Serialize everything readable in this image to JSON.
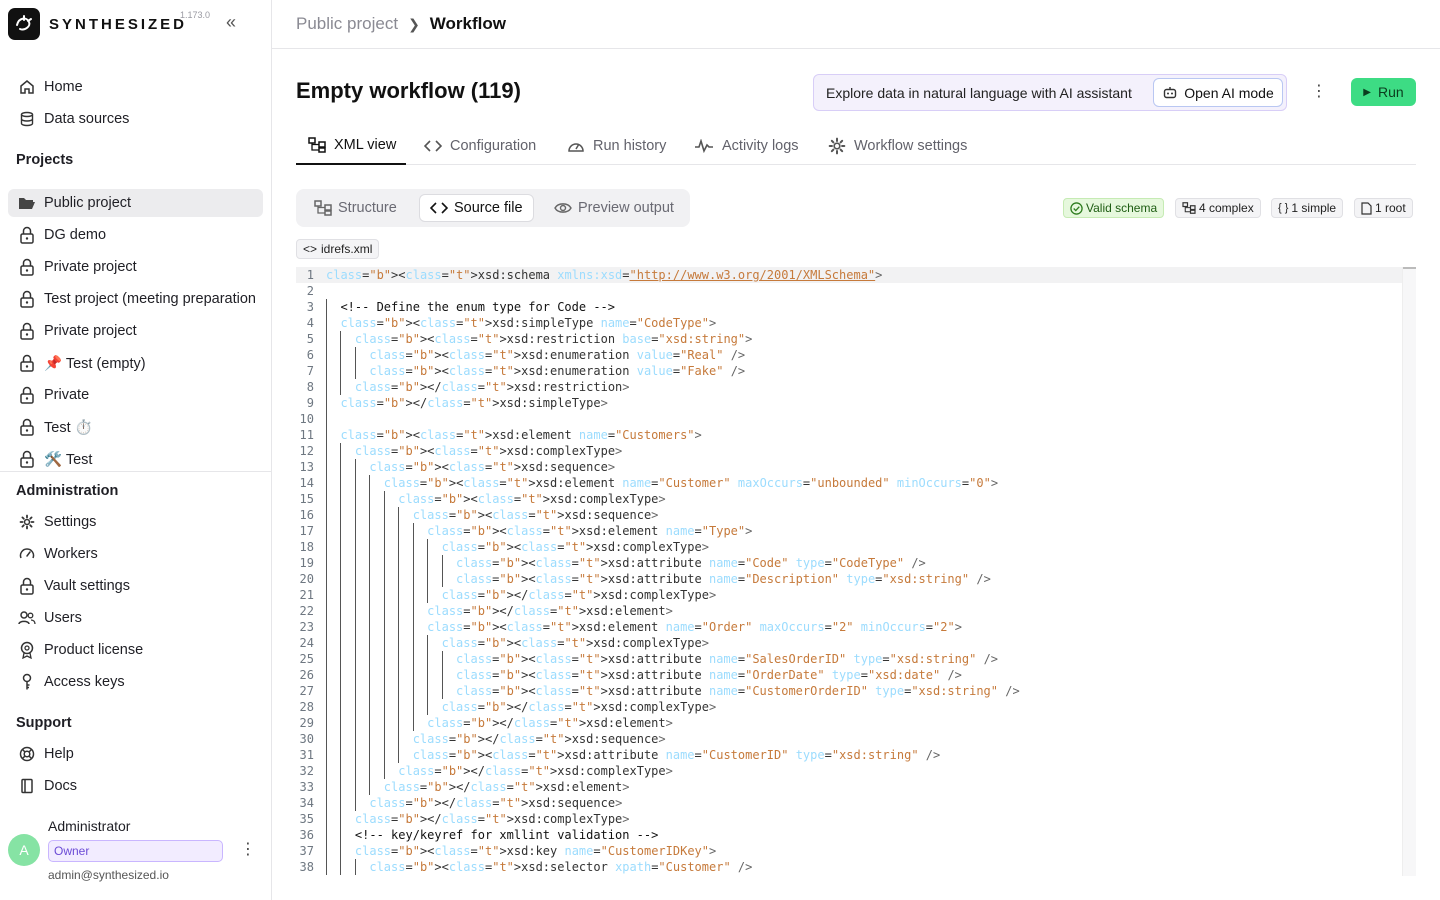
{
  "app": {
    "brand": "SYNTHESIZED",
    "version": "1.173.0",
    "collapse_icon": "«"
  },
  "nav": {
    "home": "Home",
    "data_sources": "Data sources",
    "projects_title": "Projects",
    "projects": [
      {
        "label": "Public project",
        "icon": "folder-open-icon"
      },
      {
        "label": "DG demo",
        "icon": "lock-icon"
      },
      {
        "label": "Private project",
        "icon": "lock-icon"
      },
      {
        "label": "Test project (meeting preparation",
        "icon": "lock-icon"
      },
      {
        "label": "Private project",
        "icon": "lock-icon"
      },
      {
        "label": "📌 Test (empty)",
        "icon": "lock-icon"
      },
      {
        "label": "Private",
        "icon": "lock-icon"
      },
      {
        "label": "Test ⏱️",
        "icon": "lock-icon"
      },
      {
        "label": "🛠️ Test",
        "icon": "lock-icon"
      }
    ],
    "admin_title": "Administration",
    "admin": [
      "Settings",
      "Workers",
      "Vault settings",
      "Users",
      "Product license",
      "Access keys"
    ],
    "support_title": "Support",
    "support": [
      "Help",
      "Docs"
    ]
  },
  "user": {
    "initial": "A",
    "name": "Administrator",
    "role": "Owner",
    "email": "admin@synthesized.io"
  },
  "breadcrumb": {
    "parent": "Public project",
    "current": "Workflow"
  },
  "page": {
    "title": "Empty workflow (119)",
    "ai_prompt": "Explore data in natural language with AI assistant",
    "ai_button": "Open AI mode",
    "run": "Run"
  },
  "tabs": [
    "XML view",
    "Configuration",
    "Run history",
    "Activity logs",
    "Workflow settings"
  ],
  "segments": [
    "Structure",
    "Source file",
    "Preview output"
  ],
  "badges": {
    "valid": "Valid schema",
    "complex": "4 complex",
    "simple": "1 simple",
    "root": "1 root"
  },
  "file": "idrefs.xml",
  "colors": {
    "accent_green": "#3ddc84",
    "owner_purple": "#6b4bd6"
  },
  "code": [
    "<xsd:schema xmlns:xsd=\"http://www.w3.org/2001/XMLSchema\">",
    "",
    "  <!-- Define the enum type for Code -->",
    "  <xsd:simpleType name=\"CodeType\">",
    "    <xsd:restriction base=\"xsd:string\">",
    "      <xsd:enumeration value=\"Real\" />",
    "      <xsd:enumeration value=\"Fake\" />",
    "    </xsd:restriction>",
    "  </xsd:simpleType>",
    "",
    "  <xsd:element name=\"Customers\">",
    "    <xsd:complexType>",
    "      <xsd:sequence>",
    "        <xsd:element name=\"Customer\" maxOccurs=\"unbounded\" minOccurs=\"0\">",
    "          <xsd:complexType>",
    "            <xsd:sequence>",
    "              <xsd:element name=\"Type\">",
    "                <xsd:complexType>",
    "                  <xsd:attribute name=\"Code\" type=\"CodeType\" />",
    "                  <xsd:attribute name=\"Description\" type=\"xsd:string\" />",
    "                </xsd:complexType>",
    "              </xsd:element>",
    "              <xsd:element name=\"Order\" maxOccurs=\"2\" minOccurs=\"2\">",
    "                <xsd:complexType>",
    "                  <xsd:attribute name=\"SalesOrderID\" type=\"xsd:string\" />",
    "                  <xsd:attribute name=\"OrderDate\" type=\"xsd:date\" />",
    "                  <xsd:attribute name=\"CustomerOrderID\" type=\"xsd:string\" />",
    "                </xsd:complexType>",
    "              </xsd:element>",
    "            </xsd:sequence>",
    "            <xsd:attribute name=\"CustomerID\" type=\"xsd:string\" />",
    "          </xsd:complexType>",
    "        </xsd:element>",
    "      </xsd:sequence>",
    "    </xsd:complexType>",
    "    <!-- key/keyref for xmllint validation -->",
    "    <xsd:key name=\"CustomerIDKey\">",
    "      <xsd:selector xpath=\"Customer\" />"
  ]
}
